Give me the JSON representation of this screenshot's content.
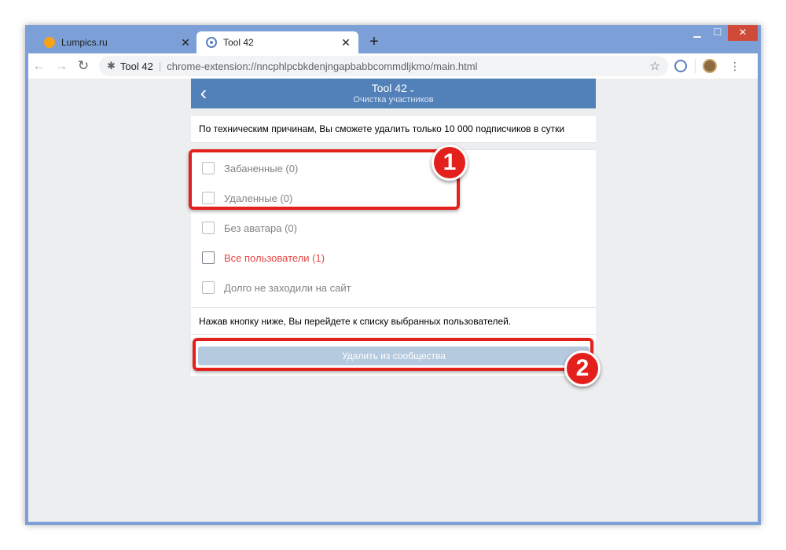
{
  "browser": {
    "tabs": [
      {
        "title": "Lumpics.ru",
        "active": false
      },
      {
        "title": "Tool 42",
        "active": true
      }
    ],
    "new_tab_label": "+",
    "close_glyph": "✕",
    "window_controls": {
      "minimize": "▁",
      "maximize": "☐",
      "close": "✕"
    },
    "toolbar": {
      "back": "←",
      "forward": "→",
      "reload": "↻",
      "site_name": "Tool 42",
      "separator": "|",
      "url": "chrome-extension://nncphlpcbkdenjngapbabbcommdljkmo/main.html",
      "bookmark_star": "☆",
      "menu": "⋮"
    }
  },
  "app": {
    "back_glyph": "‹",
    "title": "Tool 42",
    "title_chevron": "⌄",
    "subtitle": "Очистка участников",
    "notice": "По техническим причинам, Вы сможете удалить только 10 000 подписчиков в сутки",
    "options": [
      {
        "label": "Забаненные (0)",
        "checked": false
      },
      {
        "label": "Удаленные (0)",
        "checked": false
      },
      {
        "label": "Без аватара (0)",
        "checked": false
      },
      {
        "label": "Все пользователи (1)",
        "checked": false,
        "highlight_color": "#e64646"
      },
      {
        "label": "Долго не заходили на сайт",
        "checked": false
      }
    ],
    "hint": "Нажав кнопку ниже, Вы перейдете к списку выбранных пользователей.",
    "delete_button": "Удалить из сообщества"
  },
  "annotations": {
    "badge_1": "1",
    "badge_2": "2",
    "color": "#e3201b"
  },
  "colors": {
    "header_blue": "#5181b8",
    "frame_blue": "#7b9fd6",
    "button_disabled": "#b5c9df"
  }
}
